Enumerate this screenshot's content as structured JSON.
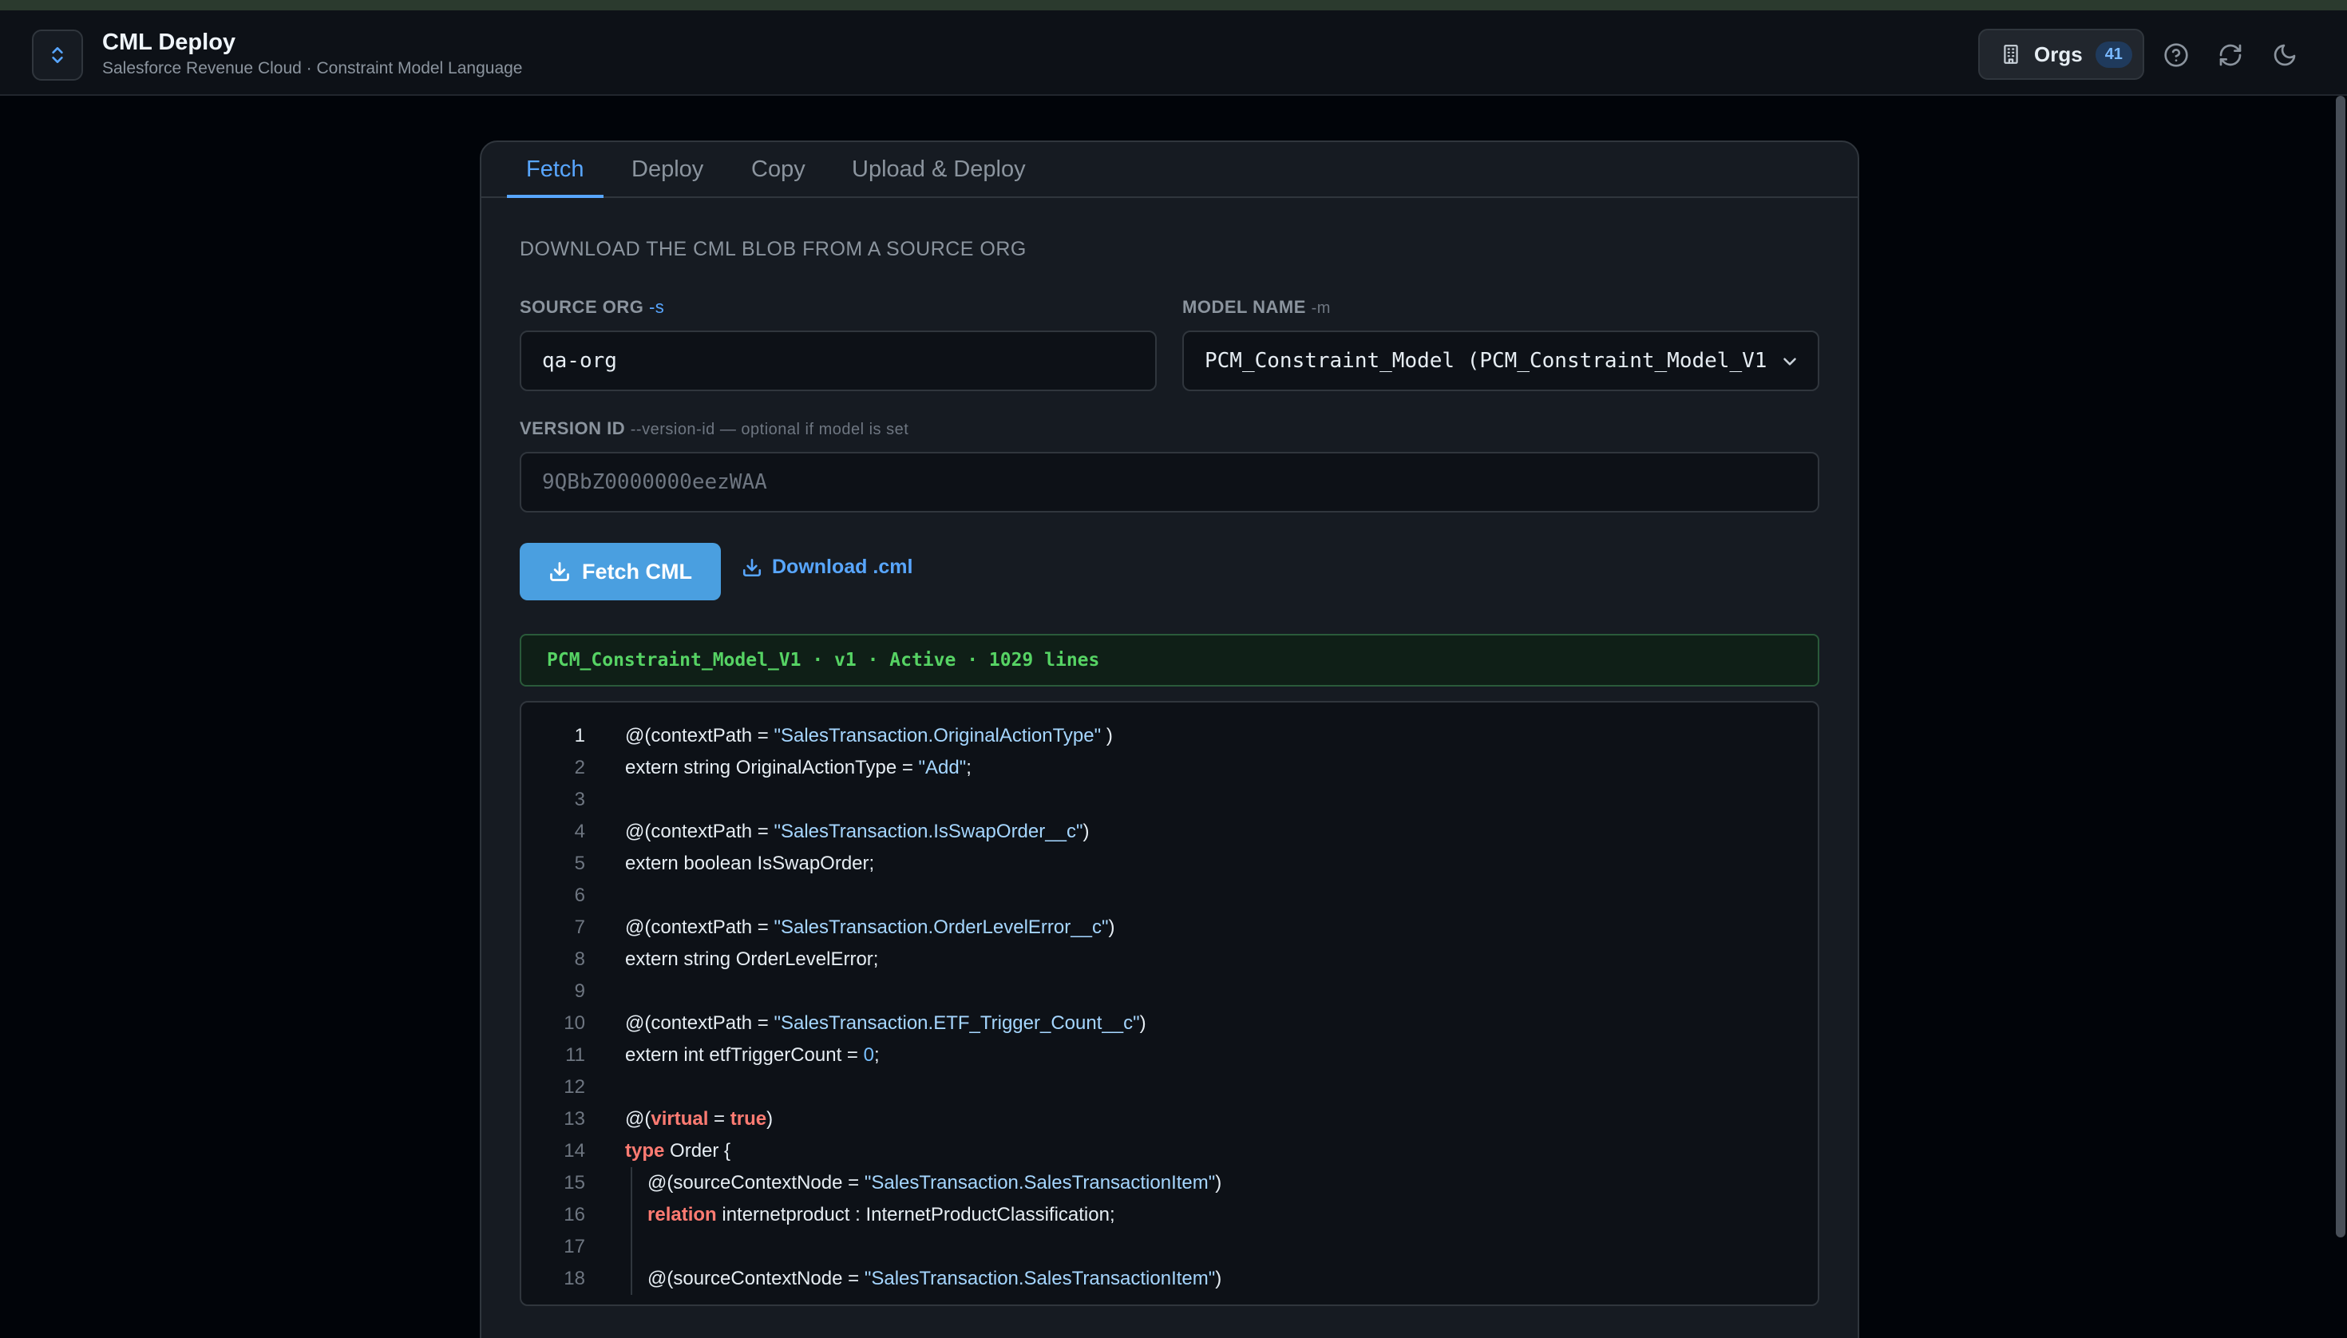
{
  "header": {
    "title": "CML Deploy",
    "subtitle": "Salesforce Revenue Cloud · Constraint Model Language",
    "orgs_label": "Orgs",
    "orgs_count": "41",
    "icons": [
      "app-swap-icon",
      "building-icon",
      "help-icon",
      "refresh-icon",
      "moon-icon"
    ]
  },
  "tabs": [
    {
      "label": "Fetch",
      "active": true
    },
    {
      "label": "Deploy",
      "active": false
    },
    {
      "label": "Copy",
      "active": false
    },
    {
      "label": "Upload & Deploy",
      "active": false
    }
  ],
  "fetch": {
    "section_title": "DOWNLOAD THE CML BLOB FROM A SOURCE ORG",
    "source_org": {
      "label": "SOURCE ORG",
      "flag": "-s",
      "value": "qa-org"
    },
    "model_name": {
      "label": "MODEL NAME",
      "flag": "-m",
      "value": "PCM_Constraint_Model (PCM_Constraint_Model_V1"
    },
    "version_id": {
      "label": "VERSION ID",
      "hint": "--version-id — optional if model is set",
      "placeholder": "9QBbZ0000000eezWAA"
    },
    "fetch_button": "Fetch CML",
    "download_link": "Download .cml",
    "status": "PCM_Constraint_Model_V1 · v1 · Active · 1029 lines"
  },
  "code_lines": [
    {
      "n": "1",
      "html": "@(contextPath = <span class=\"str\">\"SalesTransaction.OriginalActionType\"</span> )",
      "indent": false
    },
    {
      "n": "2",
      "html": "extern string OriginalActionType = <span class=\"str\">\"Add\"</span>;",
      "indent": false
    },
    {
      "n": "3",
      "html": "",
      "indent": false
    },
    {
      "n": "4",
      "html": "@(contextPath = <span class=\"str\">\"SalesTransaction.IsSwapOrder__c\"</span>)",
      "indent": false
    },
    {
      "n": "5",
      "html": "extern boolean IsSwapOrder;",
      "indent": false
    },
    {
      "n": "6",
      "html": "",
      "indent": false
    },
    {
      "n": "7",
      "html": "@(contextPath = <span class=\"str\">\"SalesTransaction.OrderLevelError__c\"</span>)",
      "indent": false
    },
    {
      "n": "8",
      "html": "extern string OrderLevelError;",
      "indent": false
    },
    {
      "n": "9",
      "html": "",
      "indent": false
    },
    {
      "n": "10",
      "html": "@(contextPath = <span class=\"str\">\"SalesTransaction.ETF_Trigger_Count__c\"</span>)",
      "indent": false
    },
    {
      "n": "11",
      "html": "extern int etfTriggerCount = <span class=\"num\">0</span>;",
      "indent": false
    },
    {
      "n": "12",
      "html": "",
      "indent": false
    },
    {
      "n": "13",
      "html": "@(<span class=\"kw\">virtual</span> = <span class=\"kw\">true</span>)",
      "indent": false
    },
    {
      "n": "14",
      "html": "<span class=\"kw\">type</span> Order {",
      "indent": false
    },
    {
      "n": "15",
      "html": "@(sourceContextNode = <span class=\"str\">\"SalesTransaction.SalesTransactionItem\"</span>)",
      "indent": true
    },
    {
      "n": "16",
      "html": "<span class=\"kw\">relation</span> internetproduct : InternetProductClassification;",
      "indent": true
    },
    {
      "n": "17",
      "html": "",
      "indent": true
    },
    {
      "n": "18",
      "html": "@(sourceContextNode = <span class=\"str\">\"SalesTransaction.SalesTransactionItem\"</span>)",
      "indent": true
    }
  ]
}
